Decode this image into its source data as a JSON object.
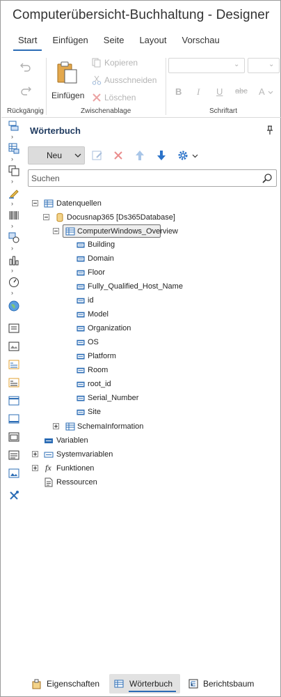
{
  "window": {
    "title": "Computerübersicht-Buchhaltung - Designer"
  },
  "ribbon_tabs": [
    "Start",
    "Einfügen",
    "Seite",
    "Layout",
    "Vorschau"
  ],
  "ribbon": {
    "undo_group_label": "Rückgängig",
    "clipboard_group_label": "Zwischenablage",
    "font_group_label": "Schriftart",
    "paste_label": "Einfügen",
    "copy_label": "Kopieren",
    "cut_label": "Ausschneiden",
    "delete_label": "Löschen",
    "format_buttons": [
      "B",
      "I",
      "U",
      "abc",
      "A"
    ]
  },
  "panel": {
    "title": "Wörterbuch",
    "new_label": "Neu",
    "search_placeholder": "Suchen"
  },
  "tree": {
    "root": "Datenquellen",
    "database": "Docusnap365 [Ds365Database]",
    "table": "ComputerWindows_Overview",
    "columns": [
      "Building",
      "Domain",
      "Floor",
      "Fully_Qualified_Host_Name",
      "id",
      "Model",
      "Organization",
      "OS",
      "Platform",
      "Room",
      "root_id",
      "Serial_Number",
      "Site"
    ],
    "schema": "SchemaInformation",
    "variables": "Variablen",
    "system_variables": "Systemvariablen",
    "functions": "Funktionen",
    "resources": "Ressourcen"
  },
  "bottom_tabs": [
    "Eigenschaften",
    "Wörterbuch",
    "Berichtsbaum"
  ],
  "colors": {
    "accent": "#2b6cb5",
    "icon_blue": "#3a74c4",
    "delete_red": "#e05a5a",
    "db_yellow": "#e0a030"
  }
}
